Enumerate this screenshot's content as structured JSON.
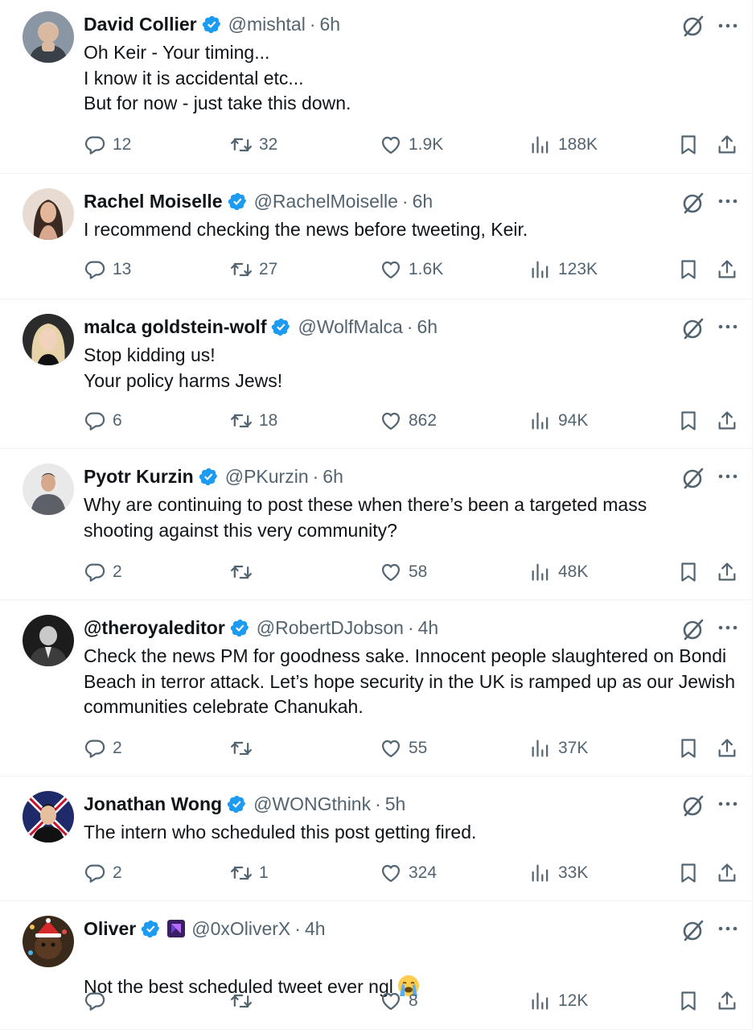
{
  "colors": {
    "text": "#0f1419",
    "muted": "#536471",
    "verified": "#1d9bf0",
    "divider": "#eff3f4"
  },
  "tweets": [
    {
      "name": "David Collier",
      "handle": "@mishtal",
      "time": "6h",
      "text": "Oh Keir - Your timing...\nI know it is accidental etc...\nBut for now - just take this down.",
      "replies": "12",
      "reposts": "32",
      "likes": "1.9K",
      "views": "188K"
    },
    {
      "name": "Rachel Moiselle",
      "handle": "@RachelMoiselle",
      "time": "6h",
      "text": "I recommend checking the news before tweeting, Keir.",
      "replies": "13",
      "reposts": "27",
      "likes": "1.6K",
      "views": "123K"
    },
    {
      "name": "malca goldstein-wolf",
      "handle": "@WolfMalca",
      "time": "6h",
      "text": "Stop kidding us!\nYour policy harms Jews!",
      "replies": "6",
      "reposts": "18",
      "likes": "862",
      "views": "94K"
    },
    {
      "name": "Pyotr Kurzin",
      "handle": "@PKurzin",
      "time": "6h",
      "text": "Why are continuing to post these when there’s been a targeted mass shooting against this very community?",
      "replies": "2",
      "reposts": "",
      "likes": "58",
      "views": "48K"
    },
    {
      "name": "@theroyaleditor",
      "handle": "@RobertDJobson",
      "time": "4h",
      "text": "Check the news PM for goodness sake. Innocent people slaughtered on Bondi Beach in terror attack. Let’s hope security in the UK is ramped up as our Jewish communities celebrate Chanukah.",
      "replies": "2",
      "reposts": "",
      "likes": "55",
      "views": "37K"
    },
    {
      "name": "Jonathan Wong",
      "handle": "@WONGthink",
      "time": "5h",
      "text": "The intern who scheduled this post getting fired.",
      "replies": "2",
      "reposts": "1",
      "likes": "324",
      "views": "33K"
    },
    {
      "name": "Oliver",
      "handle": "@0xOliverX",
      "time": "4h",
      "text": "Not the best scheduled tweet ever ngl",
      "emoji": "loudly-crying-face-icon",
      "replies": "",
      "reposts": "",
      "likes": "8",
      "views": "12K"
    }
  ]
}
